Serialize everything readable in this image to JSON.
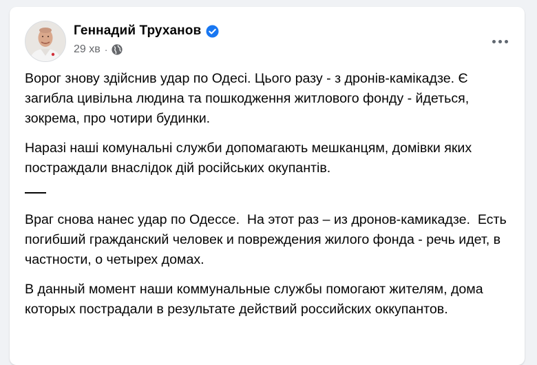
{
  "post": {
    "author_name": "Геннадий Труханов",
    "verified": true,
    "timestamp": "29 хв",
    "audience_icon": "globe-icon",
    "more_icon": "more-horizontal-icon",
    "paragraphs_uk": [
      "Ворог знову здійснив удар по Одесі. Цього разу - з дронів-камікадзе. Є загибла цивільна людина та пошкодження житлового фонду - йдеться, зокрема, про чотири будинки.",
      "Наразі наші комунальні служби допомагають мешканцям, домівки яких постраждали внаслідок дій російських окупантів."
    ],
    "separator": "_____",
    "paragraphs_ru": [
      "Враг снова нанес удар по Одессе.  На этот раз – из дронов-камикадзе.  Есть погибший гражданский человек и повреждения жилого фонда - речь идет, в частности, о четырех домах.",
      "В данный момент наши коммунальные службы помогают жителям, дома которых пострадали в результате действий российских оккупантов."
    ]
  },
  "colors": {
    "page_bg": "#f0f2f5",
    "card_bg": "#ffffff",
    "verified_blue": "#1877f2",
    "secondary_text": "#65676b",
    "primary_text": "#050505"
  }
}
